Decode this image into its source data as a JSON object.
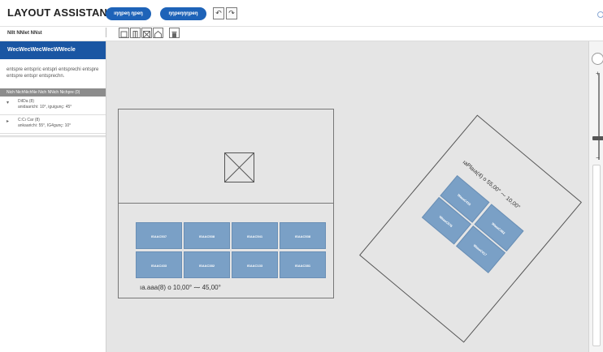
{
  "app": {
    "title": "LAYOUT ASSISTANT"
  },
  "toolbar": {
    "pill1_label": "ıŋŋpeŋ ŋpeŋ",
    "pill2_label": "ŋŋpeŋŋŋpeŋ",
    "undo_symbol": "↶",
    "redo_symbol": "↷"
  },
  "secondbar": {
    "section_label": "NIIt NNlet NNst"
  },
  "tools": [
    "rectangle-tool",
    "column-tool",
    "image-tool",
    "shape-tool",
    "delete-tool"
  ],
  "sidebar": {
    "header": "WecWecWecWecWWecle",
    "description": "entspre entspric entspri entsprechi entspre entspre entspr entsprechn.",
    "subhead": "Nich NichNichNe Nich NNich Nichpre (0)",
    "items": [
      {
        "title": "DiIDa (8)",
        "detail": "anidaarichi: 10°, iguigunç: 45°"
      },
      {
        "title": "C:Cı Car (8)",
        "detail": "ankaarichi: 55°, IG4gunç: 10°"
      }
    ]
  },
  "canvas": {
    "layout_label": "ıa.aaa(8) o 10,00° ⁓ 45,00°",
    "rotated_label": "ıaPlaıa(4) o 55,00° ⁓ 10,00°",
    "tile_labels": [
      "ISAAC537",
      "ISAAC538",
      "ISAAC541",
      "ISAAC538",
      "ISAAC433",
      "ISAAC382",
      "ISAAC133",
      "ISAAC381"
    ],
    "rotated_tile_labels": [
      "WaaaC418",
      "WaaaC576",
      "WaaaC482",
      "WaaaC417"
    ]
  },
  "zoom": {
    "plus": "+",
    "minus": "−"
  },
  "colors": {
    "accent": "#1a56a3",
    "button": "#1e63b8",
    "tile": "#7aa0c6",
    "canvas": "#e5e5e5"
  }
}
